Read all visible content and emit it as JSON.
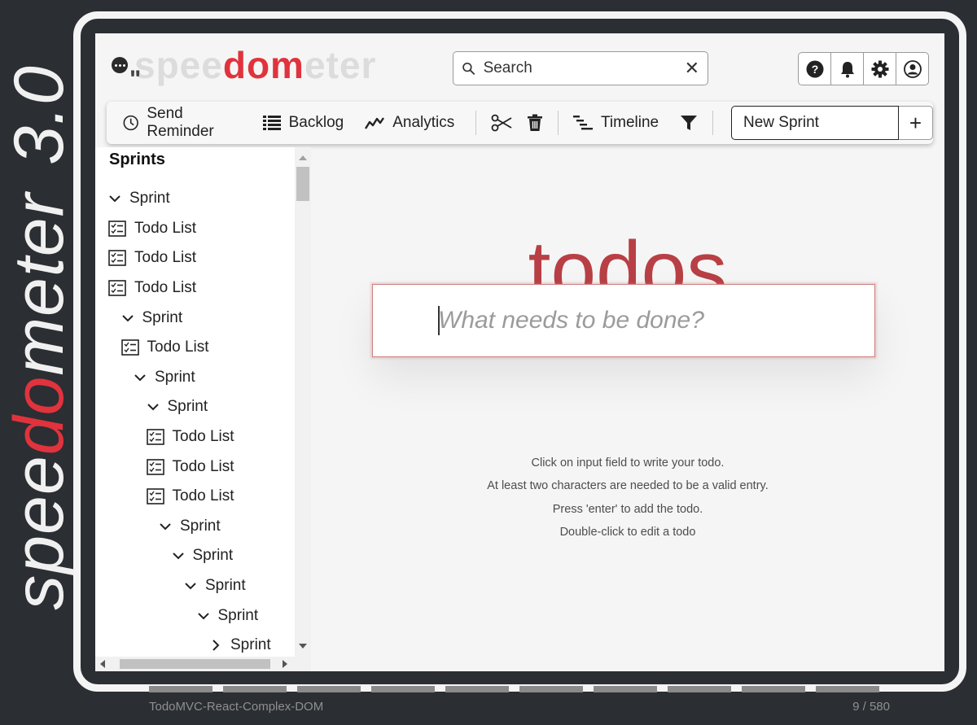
{
  "brand": {
    "vertical_prefix": "spee",
    "vertical_accent": "do",
    "vertical_suffix": "meter",
    "version": "3.0",
    "logo_prefix": "spee",
    "logo_accent": "dom",
    "logo_suffix": "eter",
    "accent_color": "#e0333d"
  },
  "header": {
    "search": {
      "placeholder": "Search",
      "clear_icon": "close-icon"
    },
    "icons": [
      "help-icon",
      "bell-icon",
      "gear-icon",
      "user-icon"
    ]
  },
  "toolbar": {
    "send_reminder": "Send Reminder",
    "backlog": "Backlog",
    "analytics": "Analytics",
    "timeline": "Timeline",
    "new_sprint_value": "New Sprint",
    "add_label": "+"
  },
  "sidebar": {
    "title": "Sprints",
    "items": [
      {
        "type": "sprint",
        "label": "Sprint",
        "expanded": true,
        "level": 0
      },
      {
        "type": "todo",
        "label": "Todo List",
        "level": 1
      },
      {
        "type": "todo",
        "label": "Todo List",
        "level": 1
      },
      {
        "type": "todo",
        "label": "Todo List",
        "level": 1
      },
      {
        "type": "sprint",
        "label": "Sprint",
        "expanded": true,
        "level": 1
      },
      {
        "type": "todo",
        "label": "Todo List",
        "level": 2
      },
      {
        "type": "sprint",
        "label": "Sprint",
        "expanded": true,
        "level": 2
      },
      {
        "type": "sprint",
        "label": "Sprint",
        "expanded": true,
        "level": 3
      },
      {
        "type": "todo",
        "label": "Todo List",
        "level": 4
      },
      {
        "type": "todo",
        "label": "Todo List",
        "level": 4
      },
      {
        "type": "todo",
        "label": "Todo List",
        "level": 4
      },
      {
        "type": "sprint",
        "label": "Sprint",
        "expanded": true,
        "level": 4
      },
      {
        "type": "sprint",
        "label": "Sprint",
        "expanded": true,
        "level": 5
      },
      {
        "type": "sprint",
        "label": "Sprint",
        "expanded": true,
        "level": 6
      },
      {
        "type": "sprint",
        "label": "Sprint",
        "expanded": true,
        "level": 7
      },
      {
        "type": "sprint",
        "label": "Sprint",
        "expanded": false,
        "level": 8
      }
    ]
  },
  "main": {
    "title": "todos",
    "title_color": "#b83f45",
    "new_todo_placeholder": "What needs to be done?",
    "help": [
      "Click on input field to write your todo.",
      "At least two characters are needed to be a valid entry.",
      "Press 'enter' to add the todo.",
      "Double-click to edit a todo"
    ]
  },
  "footer": {
    "benchmark_name": "TodoMVC-React-Complex-DOM",
    "progress_text": "9 / 580",
    "progress_segments": 10
  }
}
